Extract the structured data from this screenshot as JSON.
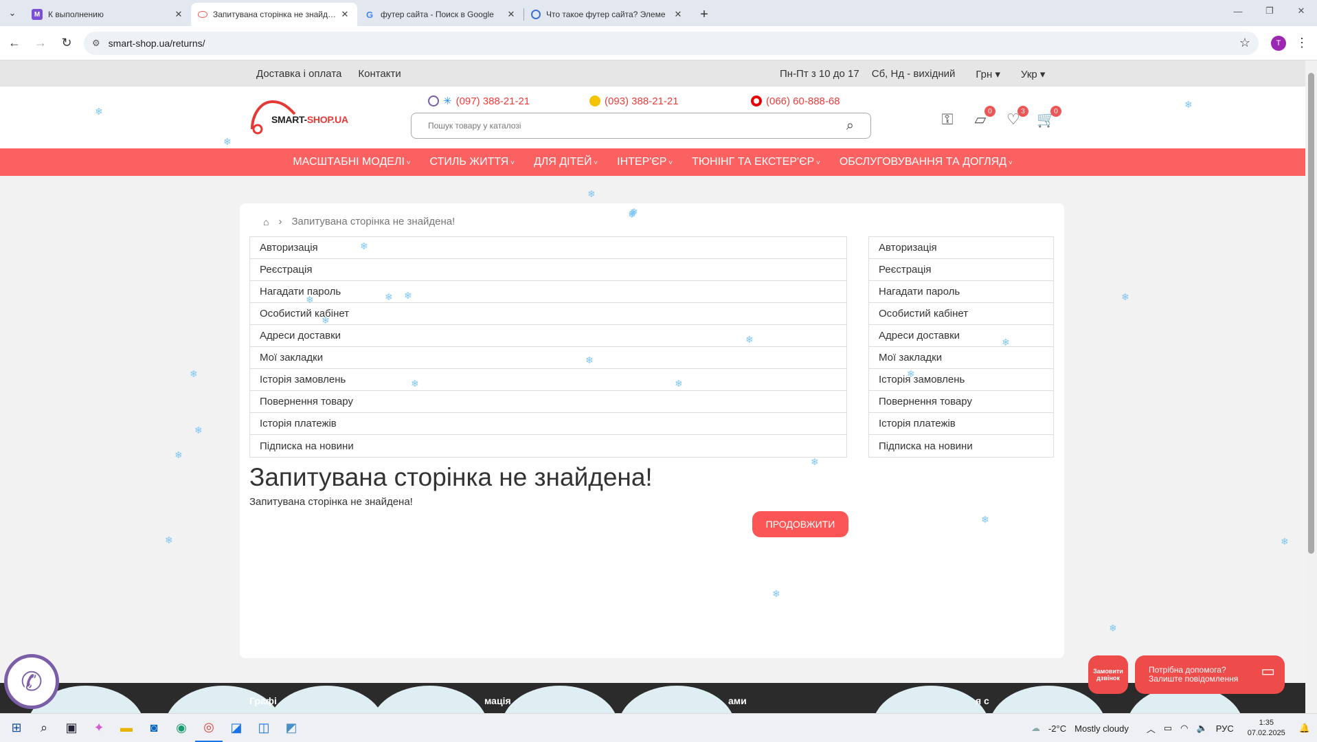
{
  "browser": {
    "tabs": [
      {
        "title": "К выполнению",
        "fav_letter": "M",
        "fav_color": "#7b4fd6",
        "active": false
      },
      {
        "title": "Запитувана сторінка не знайдена!",
        "fav_letter": "",
        "fav_color": "#ffffff",
        "active": true
      },
      {
        "title": "футер сайта - Поиск в Google",
        "fav_letter": "G",
        "fav_color": "#4285f4",
        "active": false
      },
      {
        "title": "Что такое футер сайта? Элеме",
        "fav_letter": "",
        "fav_color": "#3b6fd6",
        "active": false
      }
    ],
    "url": "smart-shop.ua/returns/",
    "profile_initial": "T"
  },
  "topstrip": {
    "delivery": "Доставка і оплата",
    "contacts": "Контакти",
    "hours": "Пн-Пт з 10 до 17",
    "weekend": "Сб, Нд - вихідний",
    "currency": "Грн",
    "language": "Укр"
  },
  "header": {
    "logo_main": "SMART-",
    "logo_accent": "SHOP.UA",
    "phones": [
      "(097) 388-21-21",
      "(093) 388-21-21",
      "(066) 60-888-68"
    ],
    "search_placeholder": "Пошук товару у каталозі",
    "badges": {
      "compare": "0",
      "wishlist": "3",
      "cart": "0"
    }
  },
  "categories": [
    "Масштабні моделі",
    "Стиль життя",
    "Для дітей",
    "Інтер'єр",
    "Тюнінг та екстер'єр",
    "Обслуговування та догляд"
  ],
  "breadcrumb": "Запитувана сторінка не знайдена!",
  "account_links": [
    "Авторизація",
    "Реєстрація",
    "Нагадати пароль",
    "Особистий кабінет",
    "Адреси доставки",
    "Мої закладки",
    "Історія замовлень",
    "Повернення товару",
    "Історія платежів",
    "Підписка на новини"
  ],
  "main": {
    "heading": "Запитувана сторінка не знайдена!",
    "text": "Запитувана сторінка не знайдена!",
    "continue": "ПРОДОВЖИТИ"
  },
  "footer": {
    "col1": "Графі",
    "col2": "мація",
    "col3": "ами",
    "col4": "я с"
  },
  "widgets": {
    "callme": "Замовити дзвінок",
    "help_line1": "Потрібна допомога?",
    "help_line2": "Залиште повідомлення"
  },
  "taskbar": {
    "weather_temp": "-2°C",
    "weather_text": "Mostly cloudy",
    "lang": "РУС",
    "time": "1:35",
    "date": "07.02.2025"
  },
  "colors": {
    "brand_red": "#fb6161",
    "button_red": "#fb5555"
  }
}
